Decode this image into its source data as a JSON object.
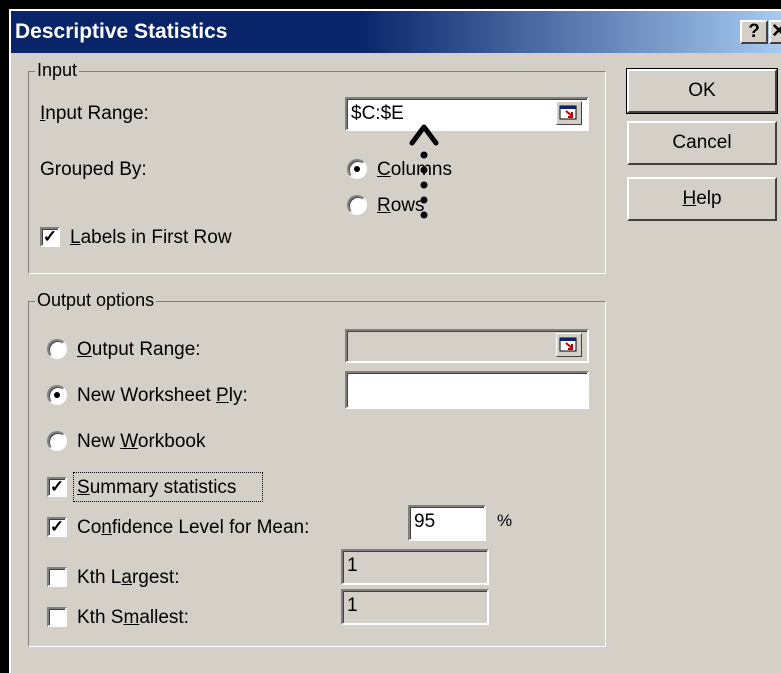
{
  "window": {
    "title": "Descriptive Statistics",
    "help_glyph": "?",
    "close_glyph": "✕"
  },
  "input": {
    "legend": "Input",
    "range_label": "Input Range:",
    "range_value": "$C:$E",
    "grouped_label": "Grouped By:",
    "columns_label": "Columns",
    "rows_label": "Rows",
    "labels_first_row": "Labels in First Row"
  },
  "output": {
    "legend": "Output options",
    "output_range_label": "Output Range:",
    "output_range_value": "",
    "new_ply_label": "New Worksheet Ply:",
    "new_ply_value": "",
    "new_workbook_label": "New Workbook",
    "summary_label": "Summary statistics",
    "confidence_label": "Confidence Level for Mean:",
    "confidence_value": "95",
    "percent": "%",
    "kth_largest_label": "Kth Largest:",
    "kth_largest_value": "1",
    "kth_smallest_label": "Kth Smallest:",
    "kth_smallest_value": "1"
  },
  "buttons": {
    "ok": "OK",
    "cancel": "Cancel",
    "help": "Help"
  }
}
